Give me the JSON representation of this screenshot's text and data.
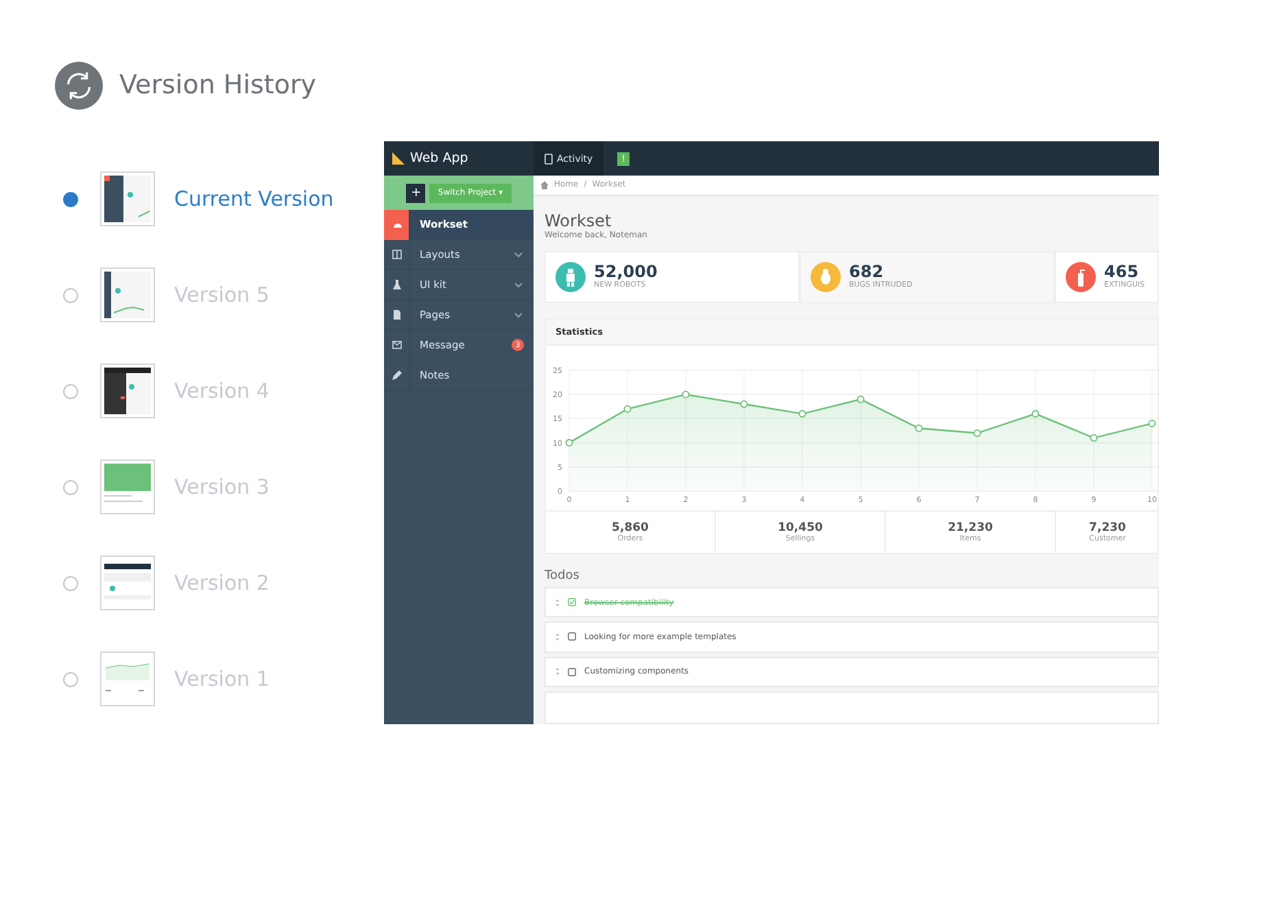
{
  "header": {
    "title": "Version History"
  },
  "versions": [
    {
      "label": "Current Version",
      "selected": true
    },
    {
      "label": "Version 5",
      "selected": false
    },
    {
      "label": "Version 4",
      "selected": false
    },
    {
      "label": "Version 3",
      "selected": false
    },
    {
      "label": "Version 2",
      "selected": false
    },
    {
      "label": "Version 1",
      "selected": false
    }
  ],
  "preview": {
    "app_title": "Web App",
    "top_tabs": [
      {
        "label": "Activity",
        "badge": "!"
      }
    ],
    "switch_project": {
      "plus": "+",
      "label": "Switch Project ▾"
    },
    "nav": [
      {
        "label": "Workset",
        "selected": true,
        "submenu": false
      },
      {
        "label": "Layouts",
        "selected": false,
        "submenu": true
      },
      {
        "label": "UI kit",
        "selected": false,
        "submenu": true
      },
      {
        "label": "Pages",
        "selected": false,
        "submenu": true
      },
      {
        "label": "Message",
        "selected": false,
        "submenu": false,
        "badge": "3"
      },
      {
        "label": "Notes",
        "selected": false,
        "submenu": false
      }
    ],
    "breadcrumb": [
      "Home",
      "/",
      "Workset"
    ],
    "page_title": "Workset",
    "subtitle": "Welcome back, Noteman",
    "stats": [
      {
        "value": "52,000",
        "label": "NEW ROBOTS",
        "color": "#3dbdb0"
      },
      {
        "value": "682",
        "label": "BUGS INTRUDED",
        "color": "#f6b93b"
      },
      {
        "value": "465",
        "label": "EXTINGUIS",
        "color": "#f4604f"
      }
    ],
    "statistics": {
      "title": "Statistics",
      "chart_data": {
        "type": "area",
        "x": [
          0,
          1,
          2,
          3,
          4,
          5,
          6,
          7,
          8,
          9,
          10
        ],
        "series": [
          {
            "color": "#6cc17a",
            "values": [
              10,
              17,
              20,
              18,
              16,
              19,
              13,
              12,
              16,
              11,
              14
            ]
          }
        ],
        "xticks": [
          0,
          1,
          2,
          3,
          4,
          5,
          6,
          7,
          8,
          9,
          10
        ],
        "yticks": [
          0,
          5,
          10,
          15,
          20,
          25
        ],
        "xlim": [
          0,
          10
        ],
        "ylim": [
          0,
          25
        ],
        "grid": true
      }
    },
    "summary": [
      {
        "value": "5,860",
        "label": "Orders"
      },
      {
        "value": "10,450",
        "label": "Sellings"
      },
      {
        "value": "21,230",
        "label": "Items"
      },
      {
        "value": "7,230",
        "label": "Customer"
      }
    ],
    "todos_title": "Todos",
    "todos": [
      {
        "text": "Browser compatibility",
        "checked": true
      },
      {
        "text": "Looking for more example templates",
        "checked": false
      },
      {
        "text": "Customizing components",
        "checked": false
      }
    ]
  }
}
